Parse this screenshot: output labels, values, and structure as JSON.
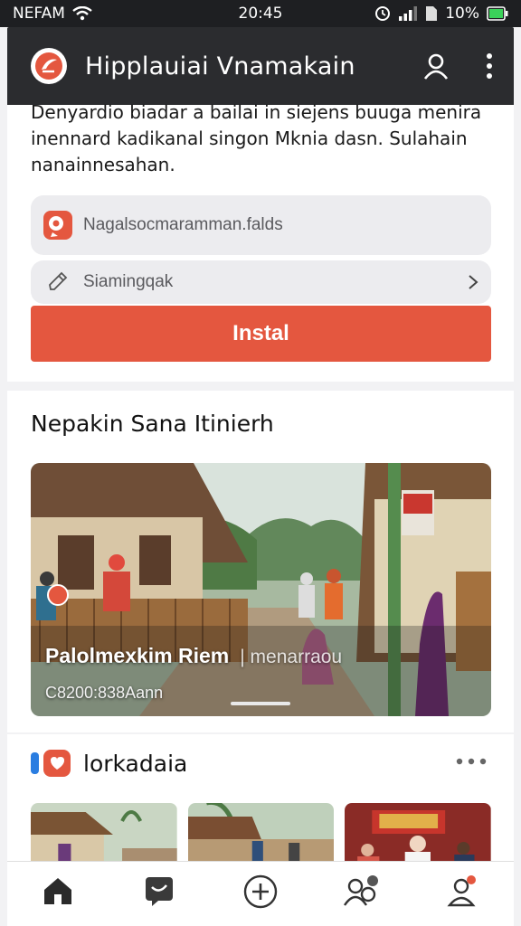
{
  "status": {
    "carrier": "NEFAM",
    "time": "20:45",
    "battery": "10%"
  },
  "app": {
    "title": "Hipplauiai Vnamakain"
  },
  "description": "Denyardio biadar a bailai in siejens buuga menira inennard kadikanal singon Mknia dasn. Sulahain nanainnesahan.",
  "fields": {
    "name_placeholder": "Nagalsocmaramman.falds",
    "subject_placeholder": "Siamingqak"
  },
  "install_label": "Instal",
  "section_title": "Nepakin Sana Itinierh",
  "hero": {
    "caption": "Palolmexkim Riem",
    "caption_faint": "| menarraou",
    "subtext": "C8200:838Aann"
  },
  "section2_title": "lorkadaia",
  "nav": [
    {
      "icon": "home-icon",
      "label": ""
    },
    {
      "icon": "chat-icon",
      "label": ""
    },
    {
      "icon": "add-icon",
      "label": ""
    },
    {
      "icon": "people-icon",
      "label": ""
    },
    {
      "icon": "profile-icon",
      "label": ""
    }
  ],
  "colors": {
    "accent": "#e4573f",
    "appbar": "#2b2c2f",
    "statusbar": "#1e1f22"
  }
}
